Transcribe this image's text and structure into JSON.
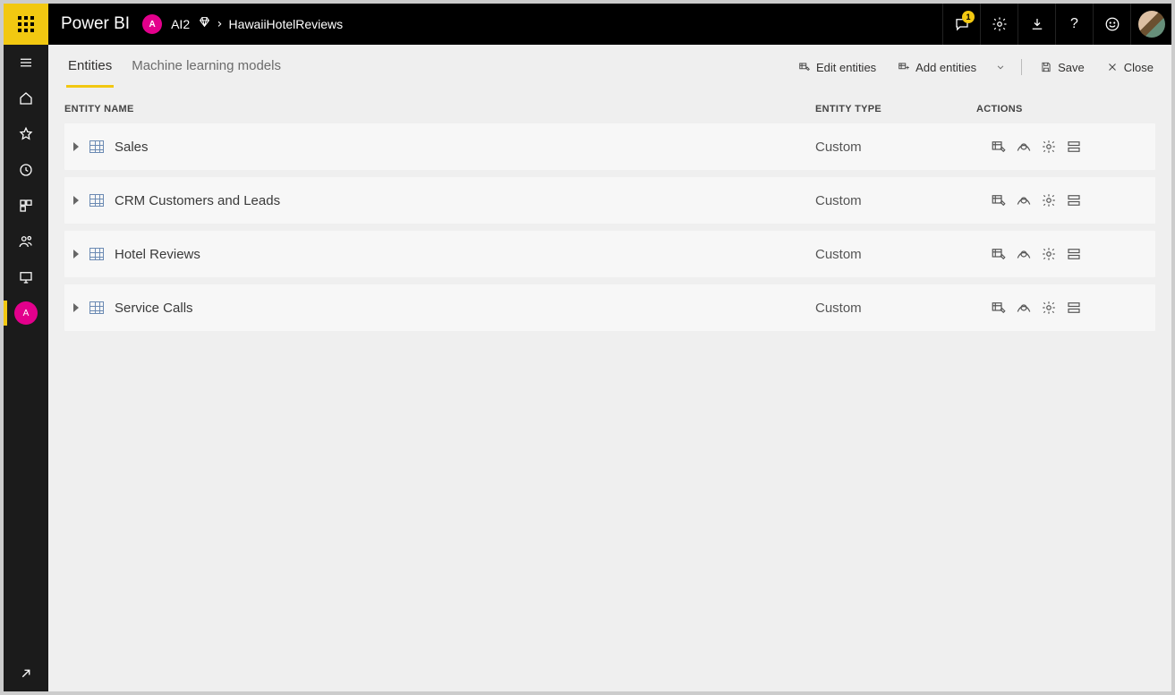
{
  "header": {
    "app_title": "Power BI",
    "workspace_initial": "A",
    "workspace_name": "AI2",
    "breadcrumb_current": "HawaiiHotelReviews",
    "notification_count": "1"
  },
  "tabs": [
    {
      "label": "Entities",
      "active": true
    },
    {
      "label": "Machine learning models",
      "active": false
    }
  ],
  "toolbar": {
    "edit_entities_label": "Edit entities",
    "add_entities_label": "Add entities",
    "save_label": "Save",
    "close_label": "Close"
  },
  "table": {
    "headers": {
      "name": "ENTITY NAME",
      "type": "ENTITY TYPE",
      "actions": "ACTIONS"
    },
    "rows": [
      {
        "name": "Sales",
        "type": "Custom"
      },
      {
        "name": "CRM Customers and Leads",
        "type": "Custom"
      },
      {
        "name": "Hotel Reviews",
        "type": "Custom"
      },
      {
        "name": "Service Calls",
        "type": "Custom"
      }
    ]
  }
}
